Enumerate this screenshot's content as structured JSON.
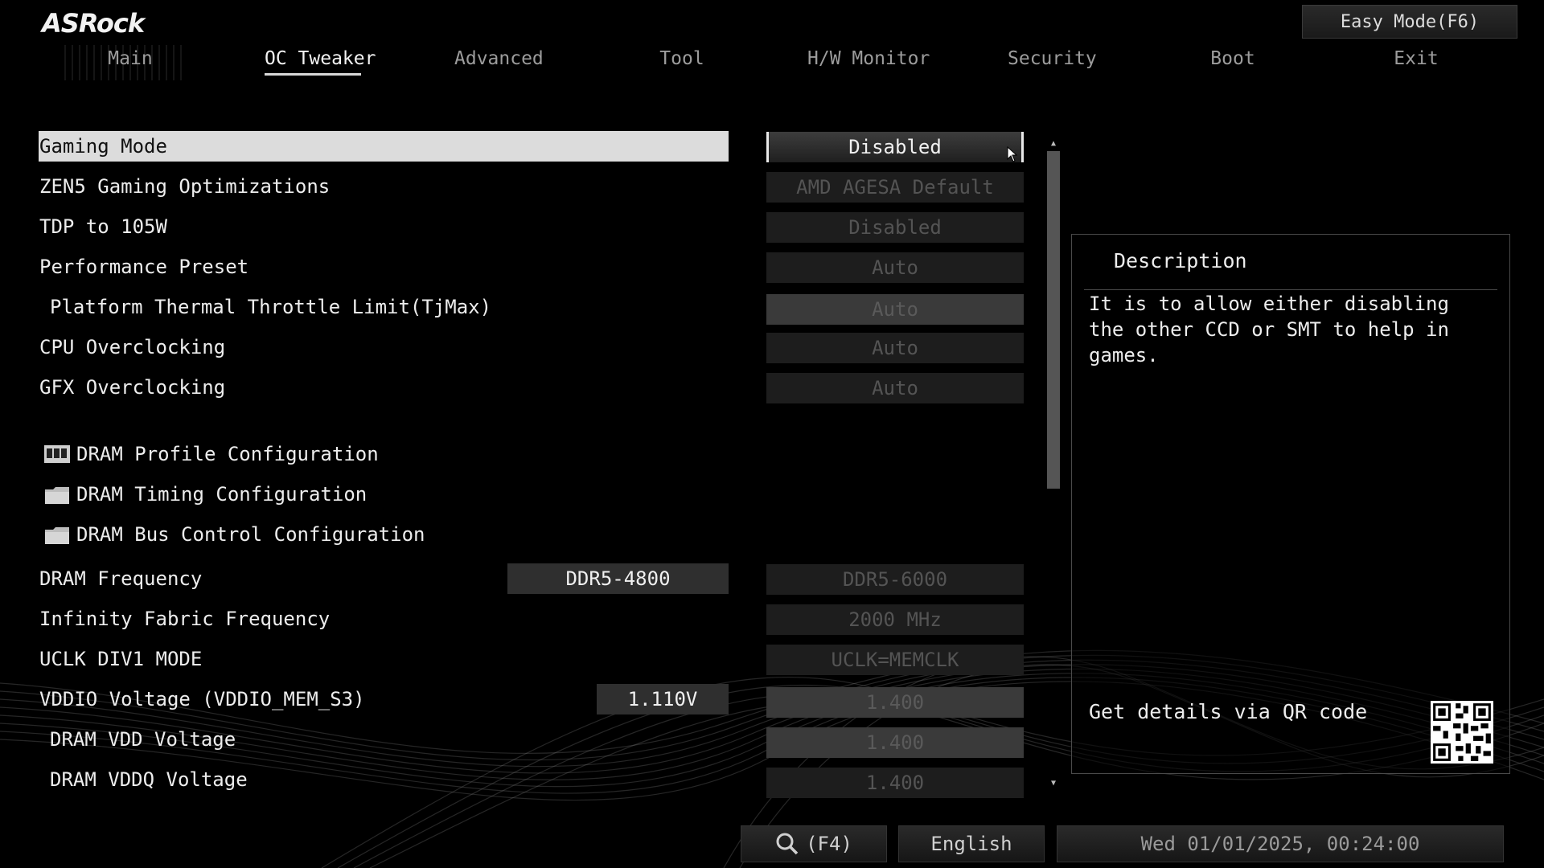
{
  "brand": "ASRock",
  "easy_mode": "Easy Mode(F6)",
  "tabs": [
    "Main",
    "OC Tweaker",
    "Advanced",
    "Tool",
    "H/W Monitor",
    "Security",
    "Boot",
    "Exit"
  ],
  "active_tab": "OC Tweaker",
  "settings": [
    {
      "label": "Gaming Mode",
      "option": "Disabled"
    },
    {
      "label": "ZEN5 Gaming Optimizations",
      "option": "AMD AGESA Default"
    },
    {
      "label": "TDP to 105W",
      "option": "Disabled"
    },
    {
      "label": "Performance Preset",
      "option": "Auto"
    },
    {
      "label": "Platform Thermal Throttle Limit(TjMax)",
      "option": "Auto"
    },
    {
      "label": "CPU Overclocking",
      "option": "Auto"
    },
    {
      "label": "GFX Overclocking",
      "option": "Auto"
    }
  ],
  "submenus": [
    {
      "label": "DRAM Profile Configuration",
      "icon": "memory-icon"
    },
    {
      "label": "DRAM Timing Configuration",
      "icon": "folder-icon"
    },
    {
      "label": "DRAM Bus Control Configuration",
      "icon": "folder-icon"
    }
  ],
  "dram": [
    {
      "label": "DRAM Frequency",
      "current": "DDR5-4800",
      "option": "DDR5-6000"
    },
    {
      "label": "Infinity Fabric Frequency",
      "current": "",
      "option": "2000 MHz"
    },
    {
      "label": "UCLK DIV1 MODE",
      "current": "",
      "option": "UCLK=MEMCLK"
    },
    {
      "label": "VDDIO Voltage (VDDIO_MEM_S3)",
      "current": "1.110V",
      "option": "1.400"
    },
    {
      "label": "DRAM VDD Voltage",
      "current": "",
      "option": "1.400"
    },
    {
      "label": "DRAM VDDQ Voltage",
      "current": "",
      "option": "1.400"
    }
  ],
  "description": {
    "title": "Description",
    "text": "It is to allow either disabling the other CCD or SMT to help in games.",
    "qr_label": "Get details via QR code"
  },
  "footer": {
    "search": "(F4)",
    "language": "English",
    "datetime": "Wed 01/01/2025, 00:24:00"
  },
  "colors": {
    "background": "#000000",
    "selected_row": "#dcdcdc",
    "text": "#ededed",
    "disabled_text": "#545454"
  }
}
